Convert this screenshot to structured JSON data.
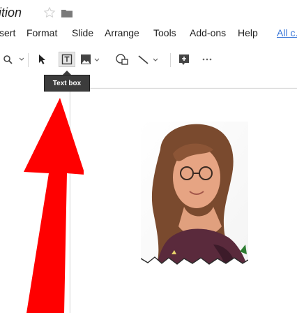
{
  "header": {
    "title_fragment": "ition"
  },
  "menu": {
    "items": [
      "sert",
      "Format",
      "Slide",
      "Arrange",
      "Tools",
      "Add-ons",
      "Help"
    ],
    "link": "All c."
  },
  "toolbar": {
    "tools": [
      {
        "name": "zoom-icon"
      },
      {
        "name": "select-cursor-icon"
      },
      {
        "name": "text-box-icon",
        "active": true
      },
      {
        "name": "image-icon"
      },
      {
        "name": "shape-icon"
      },
      {
        "name": "line-icon"
      },
      {
        "name": "comment-icon"
      },
      {
        "name": "more-icon"
      }
    ]
  },
  "tooltip": {
    "text": "Text box"
  },
  "colors": {
    "annotation_arrow": "#ff0000",
    "link": "#3c78d8",
    "tooltip_bg": "#3c3c3c"
  }
}
